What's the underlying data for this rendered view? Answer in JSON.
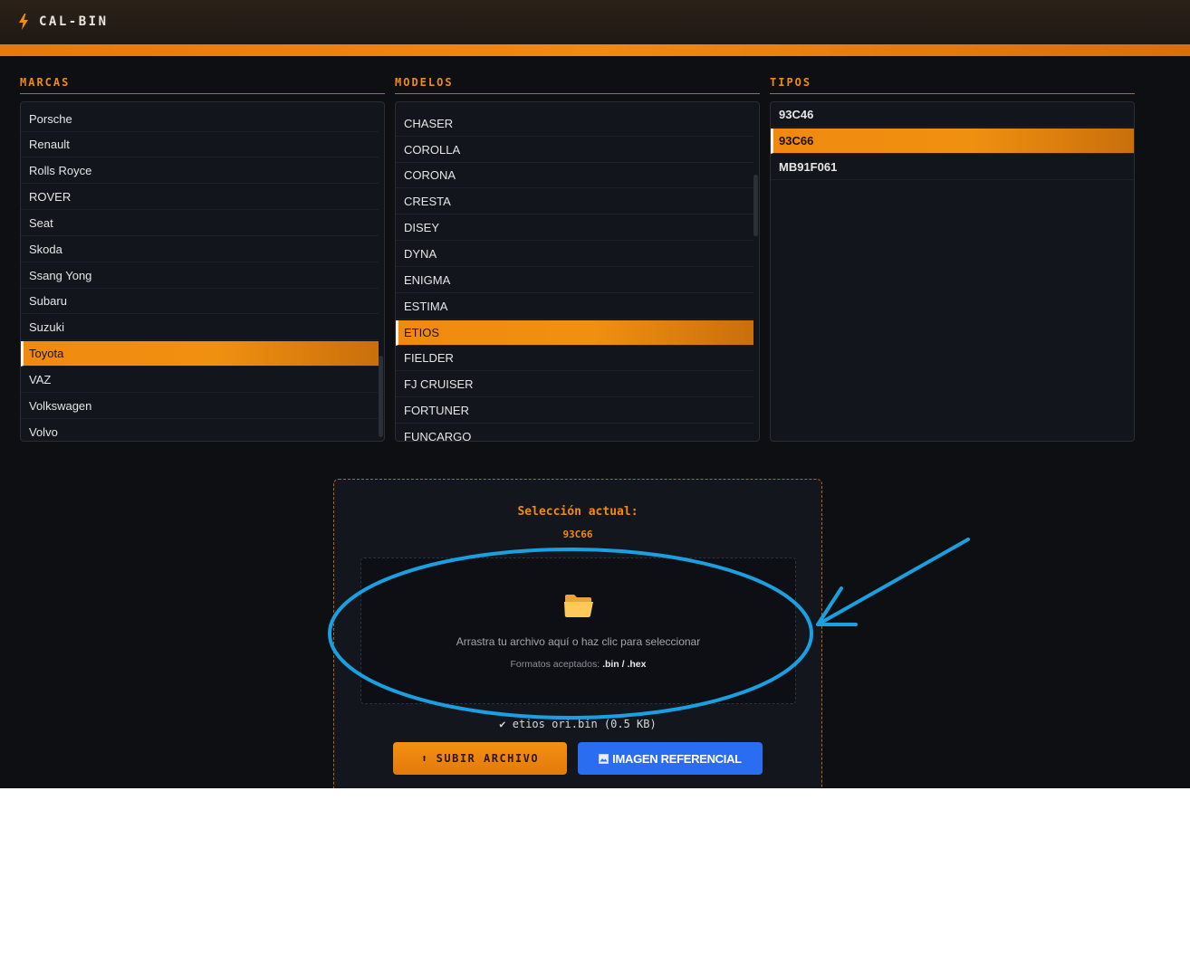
{
  "header": {
    "title": "CAL-BIN",
    "accent_color": "#f08a10"
  },
  "columns": {
    "marcas": {
      "title": "MARCAS",
      "items": [
        "Porsche",
        "Renault",
        "Rolls Royce",
        "ROVER",
        "Seat",
        "Skoda",
        "Ssang Yong",
        "Subaru",
        "Suzuki",
        "Toyota",
        "VAZ",
        "Volkswagen",
        "Volvo"
      ],
      "selected": "Toyota"
    },
    "modelos": {
      "title": "MODELOS",
      "items": [
        "CHASER",
        "COROLLA",
        "CORONA",
        "CRESTA",
        "DISEY",
        "DYNA",
        "ENIGMA",
        "ESTIMA",
        "ETIOS",
        "FIELDER",
        "FJ CRUISER",
        "FORTUNER",
        "FUNCARGO"
      ],
      "selected": "ETIOS"
    },
    "tipos": {
      "title": "TIPOS",
      "items": [
        "93C46",
        "93C66",
        "MB91F061"
      ],
      "selected": "93C66"
    }
  },
  "upload": {
    "selection_label": "Selección actual:",
    "selection_value": "93C66",
    "dropzone_text": "Arrastra tu archivo aquí o haz clic para seleccionar",
    "formats_label": "Formatos aceptados:",
    "formats_value": ".bin / .hex",
    "file_loaded": "✔ etios ori.bin (0.5 KB)",
    "upload_button": "SUBIR ARCHIVO",
    "reference_button": "IMAGEN REFERENCIAL"
  },
  "icons": {
    "brand": "lightning-bolt-icon",
    "dropzone": "folder-icon",
    "upload": "arrow-up-icon",
    "reference": "image-icon"
  },
  "colors": {
    "selection_gradient_start": "#f08a0f",
    "reference_button": "#2a6df0",
    "annotation": "#1aa0e0"
  }
}
